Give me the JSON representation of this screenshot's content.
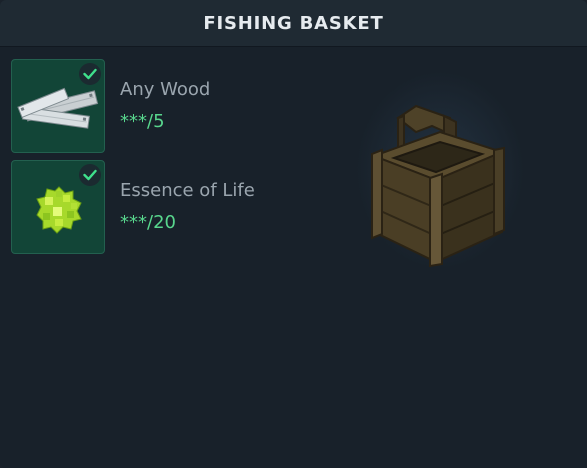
{
  "window": {
    "title": "FISHING BASKET"
  },
  "requirements": [
    {
      "name": "Any Wood",
      "count": "***/5",
      "icon": "wood-planks-icon",
      "fulfilled": true
    },
    {
      "name": "Essence of Life",
      "count": "***/20",
      "icon": "essence-of-life-icon",
      "fulfilled": true
    }
  ],
  "preview": {
    "icon": "fishing-basket-crate-icon"
  },
  "colors": {
    "panel_bg": "#18212a",
    "header_bg": "#1f2a33",
    "slot_bg": "#124537",
    "accent_green": "#58d68d",
    "check_green": "#3fe08c",
    "label_gray": "#9aa5ae"
  }
}
